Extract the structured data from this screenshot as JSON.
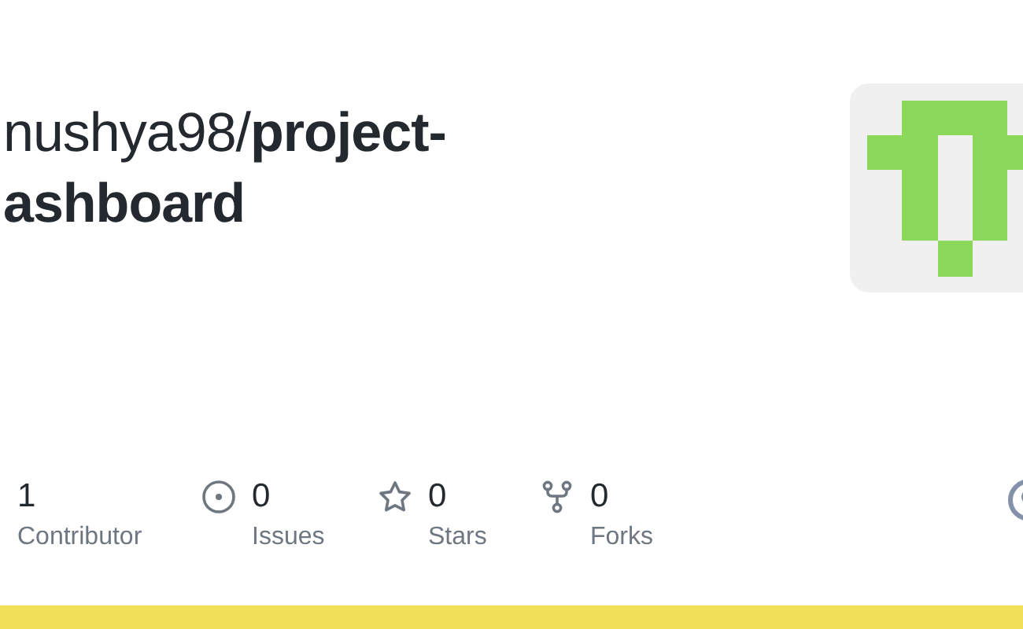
{
  "title_lines": [
    "nushya98/**project-**",
    "**ashboard**"
  ],
  "stats": [
    {
      "kind": "contributors",
      "value": "1",
      "label": "Contributor"
    },
    {
      "kind": "issues",
      "value": "0",
      "label": "Issues"
    },
    {
      "kind": "stars",
      "value": "0",
      "label": "Stars"
    },
    {
      "kind": "forks",
      "value": "0",
      "label": "Forks"
    }
  ]
}
